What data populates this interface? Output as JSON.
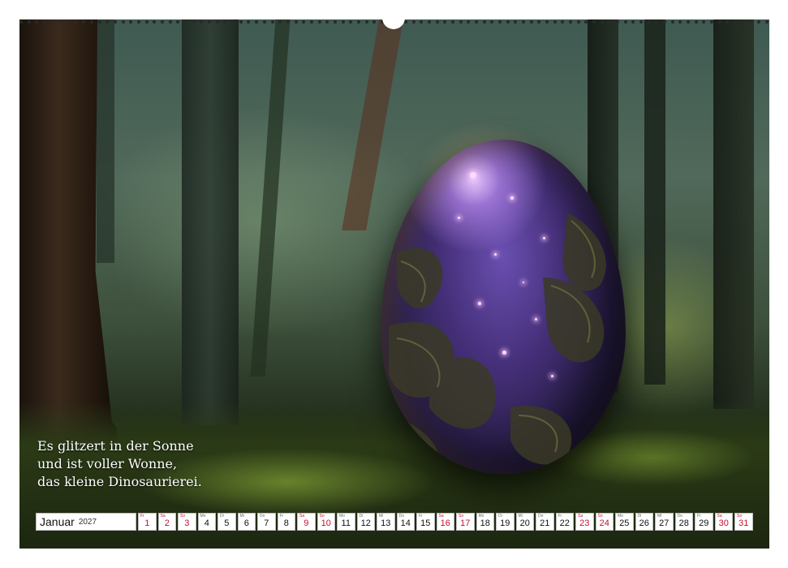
{
  "caption": {
    "line1": "Es glitzert in der Sonne",
    "line2": "und ist voller Wonne,",
    "line3": "das kleine Dinosaurierei."
  },
  "calendar": {
    "month": "Januar",
    "year": "2027",
    "days": [
      {
        "wd": "Fr",
        "d": "1",
        "red": true
      },
      {
        "wd": "Sa",
        "d": "2",
        "red": true
      },
      {
        "wd": "So",
        "d": "3",
        "red": true
      },
      {
        "wd": "Mo",
        "d": "4",
        "red": false
      },
      {
        "wd": "Di",
        "d": "5",
        "red": false
      },
      {
        "wd": "Mi",
        "d": "6",
        "red": false
      },
      {
        "wd": "Do",
        "d": "7",
        "red": false
      },
      {
        "wd": "Fr",
        "d": "8",
        "red": false
      },
      {
        "wd": "Sa",
        "d": "9",
        "red": true
      },
      {
        "wd": "So",
        "d": "10",
        "red": true
      },
      {
        "wd": "Mo",
        "d": "11",
        "red": false
      },
      {
        "wd": "Di",
        "d": "12",
        "red": false
      },
      {
        "wd": "Mi",
        "d": "13",
        "red": false
      },
      {
        "wd": "Do",
        "d": "14",
        "red": false
      },
      {
        "wd": "Fr",
        "d": "15",
        "red": false
      },
      {
        "wd": "Sa",
        "d": "16",
        "red": true
      },
      {
        "wd": "So",
        "d": "17",
        "red": true
      },
      {
        "wd": "Mo",
        "d": "18",
        "red": false
      },
      {
        "wd": "Di",
        "d": "19",
        "red": false
      },
      {
        "wd": "Mi",
        "d": "20",
        "red": false
      },
      {
        "wd": "Do",
        "d": "21",
        "red": false
      },
      {
        "wd": "Fr",
        "d": "22",
        "red": false
      },
      {
        "wd": "Sa",
        "d": "23",
        "red": true
      },
      {
        "wd": "So",
        "d": "24",
        "red": true
      },
      {
        "wd": "Mo",
        "d": "25",
        "red": false
      },
      {
        "wd": "Di",
        "d": "26",
        "red": false
      },
      {
        "wd": "Mi",
        "d": "27",
        "red": false
      },
      {
        "wd": "Do",
        "d": "28",
        "red": false
      },
      {
        "wd": "Fr",
        "d": "29",
        "red": false
      },
      {
        "wd": "Sa",
        "d": "30",
        "red": true
      },
      {
        "wd": "So",
        "d": "31",
        "red": true
      }
    ]
  },
  "colors": {
    "weekend": "#c8102e",
    "egg": "#46307a",
    "forest": "#3c4f3a"
  }
}
